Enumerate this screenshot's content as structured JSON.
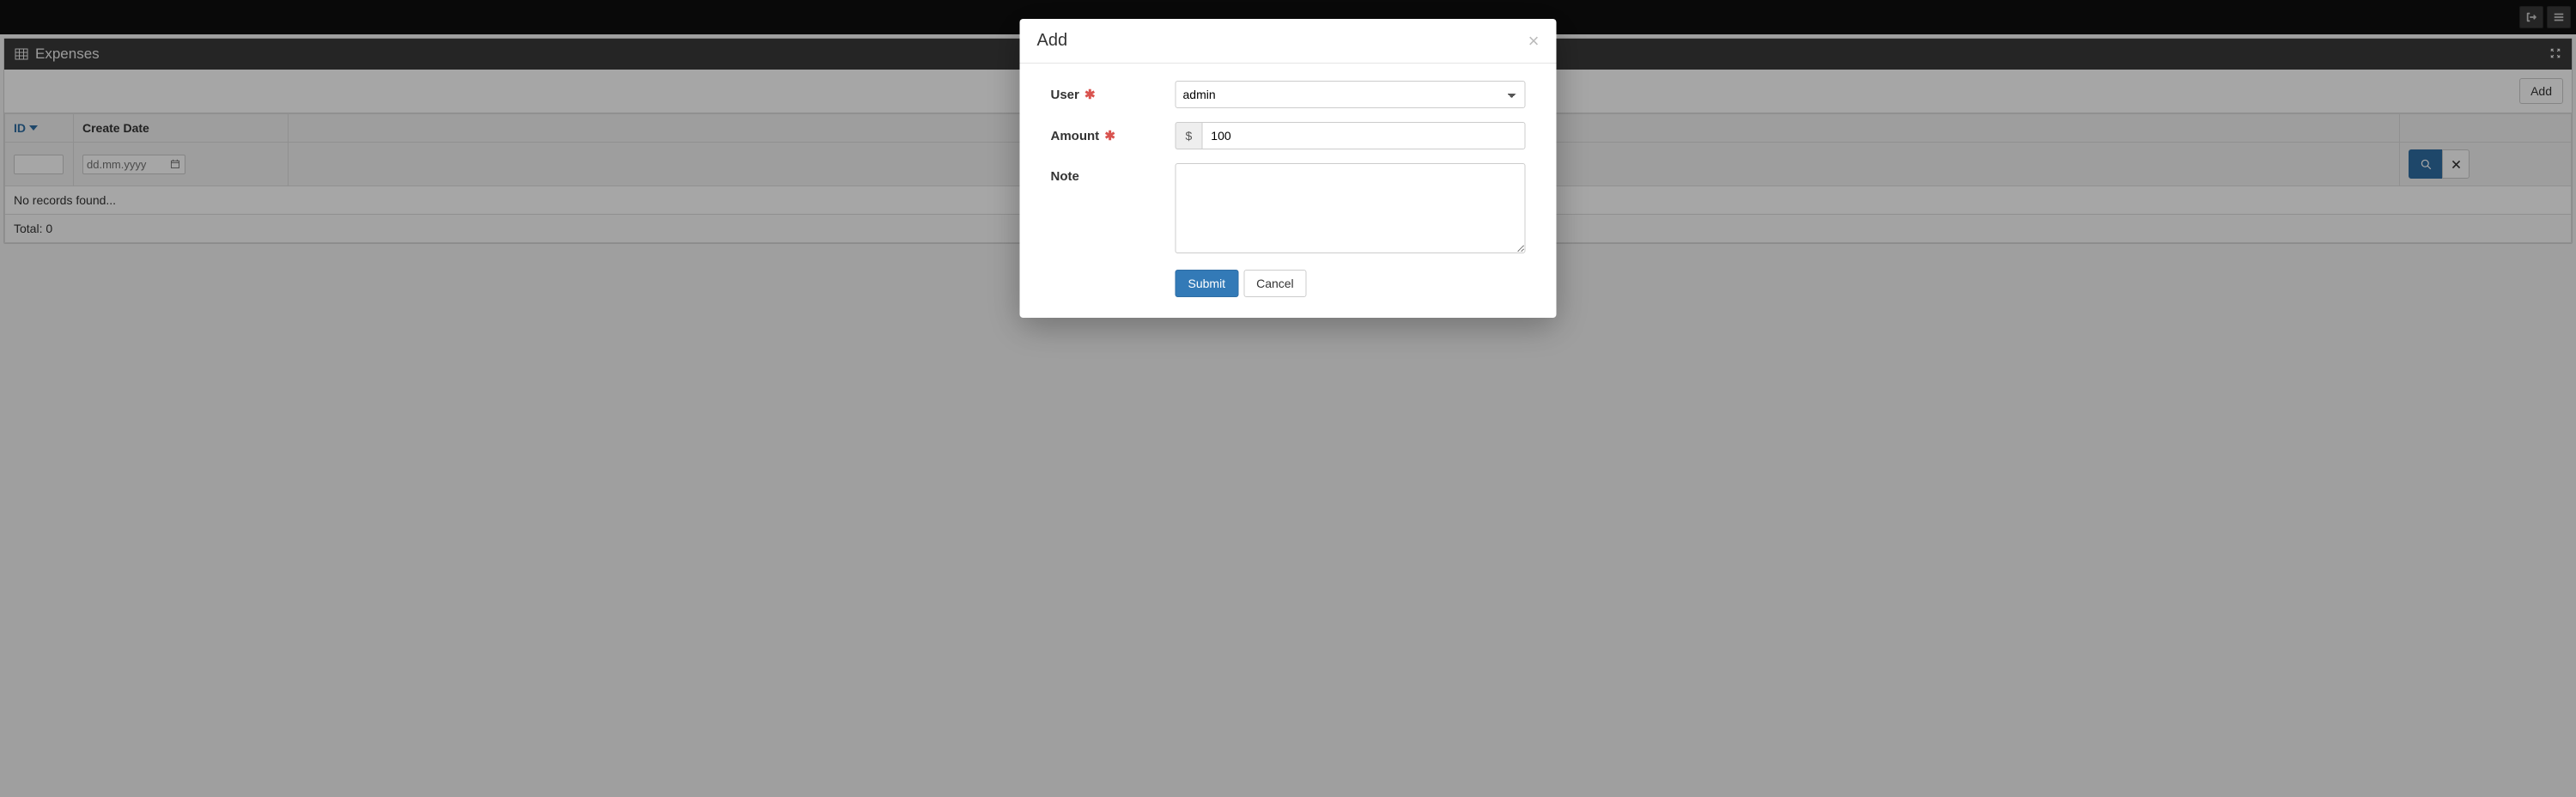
{
  "topbar": {
    "logout_icon": "logout-icon",
    "menu_icon": "menu-icon"
  },
  "panel": {
    "title": "Expenses",
    "add_button": "Add",
    "columns": {
      "id": "ID",
      "create_date": "Create Date"
    },
    "filters": {
      "id_value": "",
      "date_placeholder": "dd.mm.yyyy"
    },
    "no_records": "No records found...",
    "total_label": "Total: 0"
  },
  "modal": {
    "title": "Add",
    "fields": {
      "user_label": "User",
      "user_value": "admin",
      "amount_label": "Amount",
      "amount_currency": "$",
      "amount_value": "100",
      "note_label": "Note",
      "note_value": ""
    },
    "buttons": {
      "submit": "Submit",
      "cancel": "Cancel"
    }
  }
}
